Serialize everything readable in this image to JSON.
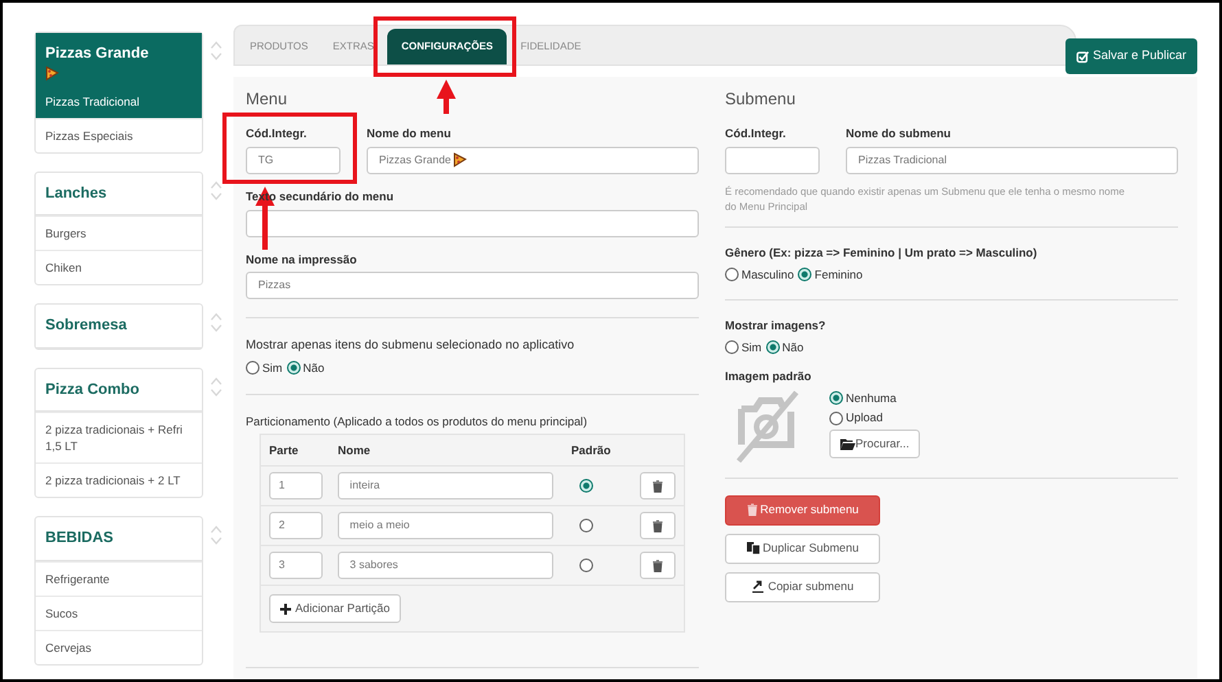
{
  "sidebar": {
    "groups": [
      {
        "title": "Pizzas Grande",
        "has_icon": true,
        "items": [
          {
            "label": "Pizzas Tradicional",
            "selected": true
          },
          {
            "label": "Pizzas Especiais",
            "selected": false
          }
        ]
      },
      {
        "title": "Lanches",
        "has_icon": false,
        "items": [
          {
            "label": "Burgers",
            "selected": false
          },
          {
            "label": "Chiken",
            "selected": false
          }
        ]
      },
      {
        "title": "Sobremesa",
        "has_icon": false
      },
      {
        "title": "Pizza Combo",
        "has_icon": false,
        "items": [
          {
            "label": "2 pizza tradicionais + Refri 1,5 LT",
            "selected": false
          },
          {
            "label": "2 pizza tradicionais + 2 LT",
            "selected": false
          }
        ]
      },
      {
        "title": "BEBIDAS",
        "has_icon": false,
        "items": [
          {
            "label": "Refrigerante",
            "selected": false
          },
          {
            "label": "Sucos",
            "selected": false
          },
          {
            "label": "Cervejas",
            "selected": false
          }
        ]
      }
    ]
  },
  "tabs": [
    {
      "label": "PRODUTOS",
      "selected": false,
      "highlighted": false
    },
    {
      "label": "EXTRAS",
      "selected": false,
      "highlighted": false
    },
    {
      "label": "CONFIGURAÇÕES",
      "selected": true,
      "highlighted": true
    },
    {
      "label": "FIDELIDADE",
      "selected": false,
      "highlighted": false
    }
  ],
  "save_button": "Salvar e Publicar",
  "menu": {
    "heading": "Menu",
    "code": {
      "label": "Cód.Integr.",
      "value": "TG",
      "highlighted": true
    },
    "name": {
      "label": "Nome do menu",
      "value": "Pizzas Grande",
      "has_icon": true
    },
    "secondary_text": {
      "label": "Texto secundário do menu"
    },
    "print_name": {
      "label": "Nome na impressão",
      "value": "Pizzas"
    },
    "show_only": {
      "label": "Mostrar apenas itens do submenu selecionado no aplicativo",
      "options": [
        {
          "label": "Sim",
          "selected": false
        },
        {
          "label": "Não",
          "selected": true
        }
      ]
    },
    "partitioning": {
      "label": "Particionamento (Aplicado a todos os produtos do menu principal)",
      "columns": [
        "Parte",
        "Nome",
        "Padrão"
      ],
      "rows": [
        {
          "part": "1",
          "name": "inteira",
          "selected": true
        },
        {
          "part": "2",
          "name": "meio a meio",
          "selected": false
        },
        {
          "part": "3",
          "name": "3 sabores",
          "selected": false
        }
      ],
      "add_button": "Adicionar Partição"
    }
  },
  "submenu": {
    "heading": "Submenu",
    "code": {
      "label": "Cód.Integr."
    },
    "name": {
      "label": "Nome do submenu",
      "value": "Pizzas Tradicional"
    },
    "hint": "É recomendado que quando existir apenas um Submenu que ele tenha o mesmo nome do Menu Principal",
    "gender": {
      "label": "Gênero (Ex: pizza => Feminino | Um prato => Masculino)",
      "options": [
        {
          "label": "Masculino",
          "selected": false
        },
        {
          "label": "Feminino",
          "selected": true
        }
      ]
    },
    "show_images": {
      "label": "Mostrar imagens?",
      "options": [
        {
          "label": "Sim",
          "selected": false
        },
        {
          "label": "Não",
          "selected": true
        }
      ]
    },
    "default_image": {
      "label": "Imagem padrão",
      "options": [
        {
          "label": "Nenhuma",
          "selected": true
        },
        {
          "label": "Upload",
          "selected": false
        }
      ],
      "browse_button": "Procurar..."
    },
    "actions": [
      {
        "kind": "danger",
        "label": "Remover submenu"
      },
      {
        "kind": "duplicate",
        "label": "Duplicar Submenu"
      },
      {
        "kind": "copy",
        "label": "Copiar submenu"
      }
    ]
  }
}
